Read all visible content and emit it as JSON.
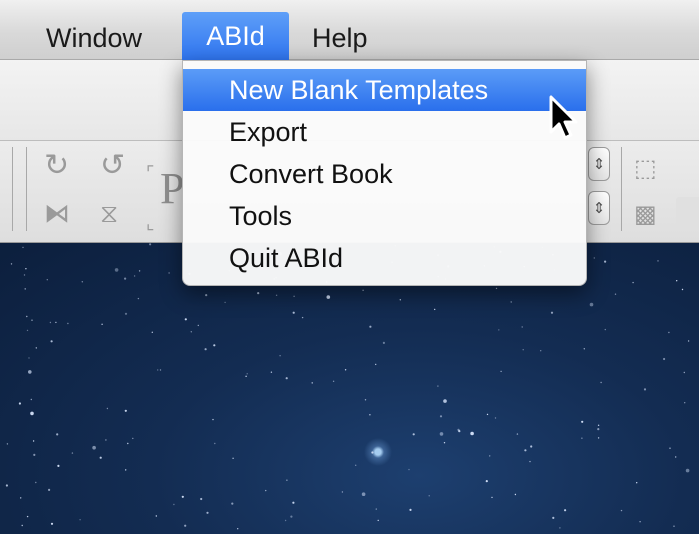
{
  "menubar": {
    "items": [
      {
        "label": "Window"
      },
      {
        "label": "ABId"
      },
      {
        "label": "Help"
      }
    ],
    "active_color": "#3b7cf0"
  },
  "dropdown": {
    "items": [
      {
        "label": "New Blank Templates",
        "highlighted": true
      },
      {
        "label": "Export",
        "highlighted": false
      },
      {
        "label": "Convert Book",
        "highlighted": false
      },
      {
        "label": "Tools",
        "highlighted": false
      },
      {
        "label": "Quit ABId",
        "highlighted": false
      }
    ],
    "highlight_color": "#3a7df0"
  },
  "toolbar": {
    "icons": [
      "rotate-cw-icon",
      "rotate-ccw-icon",
      "flip-horizontal-icon",
      "flip-vertical-icon",
      "select-rect-icon",
      "pattern-icon"
    ],
    "visible_glyph": "P"
  },
  "desktop": {
    "background": "starfield",
    "colors": {
      "top": "#1d3f6f",
      "bottom": "#0c1f3d"
    }
  },
  "cursor": {
    "icon": "arrow-cursor-icon"
  }
}
